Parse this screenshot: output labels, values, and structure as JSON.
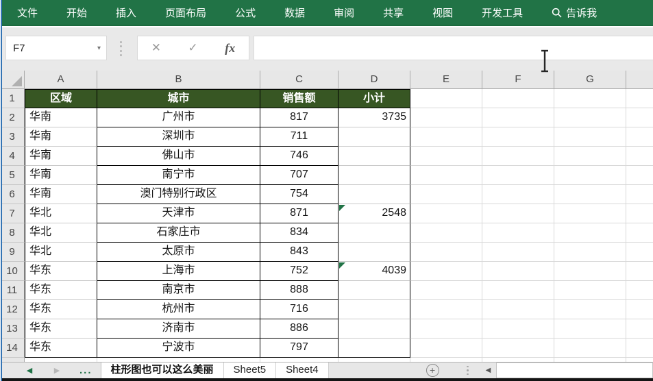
{
  "ribbon": {
    "tabs": [
      {
        "key": "file",
        "label": "文件"
      },
      {
        "key": "home",
        "label": "开始"
      },
      {
        "key": "insert",
        "label": "插入"
      },
      {
        "key": "page-layout",
        "label": "页面布局"
      },
      {
        "key": "formulas",
        "label": "公式"
      },
      {
        "key": "data",
        "label": "数据"
      },
      {
        "key": "review",
        "label": "审阅"
      },
      {
        "key": "share",
        "label": "共享"
      },
      {
        "key": "view",
        "label": "视图"
      },
      {
        "key": "developer",
        "label": "开发工具"
      }
    ],
    "tell_me_label": "告诉我"
  },
  "formula_bar": {
    "name_box_value": "F7",
    "cancel_label": "✕",
    "enter_label": "✓",
    "insert_function_label": "fx",
    "formula_value": ""
  },
  "grid": {
    "column_letters": [
      "A",
      "B",
      "C",
      "D",
      "E",
      "F",
      "G"
    ],
    "row_numbers": [
      1,
      2,
      3,
      4,
      5,
      6,
      7,
      8,
      9,
      10,
      11,
      12,
      13,
      14
    ],
    "header_row": {
      "region": "区域",
      "city": "城市",
      "sales": "销售额",
      "subtotal": "小计"
    },
    "rows": [
      {
        "region": "华南",
        "city": "广州市",
        "sales": "817",
        "subtotal": "3735",
        "flag": false
      },
      {
        "region": "华南",
        "city": "深圳市",
        "sales": "711",
        "subtotal": "",
        "flag": false
      },
      {
        "region": "华南",
        "city": "佛山市",
        "sales": "746",
        "subtotal": "",
        "flag": false
      },
      {
        "region": "华南",
        "city": "南宁市",
        "sales": "707",
        "subtotal": "",
        "flag": false
      },
      {
        "region": "华南",
        "city": "澳门特别行政区",
        "sales": "754",
        "subtotal": "",
        "flag": false
      },
      {
        "region": "华北",
        "city": "天津市",
        "sales": "871",
        "subtotal": "2548",
        "flag": true
      },
      {
        "region": "华北",
        "city": "石家庄市",
        "sales": "834",
        "subtotal": "",
        "flag": false
      },
      {
        "region": "华北",
        "city": "太原市",
        "sales": "843",
        "subtotal": "",
        "flag": false
      },
      {
        "region": "华东",
        "city": "上海市",
        "sales": "752",
        "subtotal": "4039",
        "flag": true
      },
      {
        "region": "华东",
        "city": "南京市",
        "sales": "888",
        "subtotal": "",
        "flag": false
      },
      {
        "region": "华东",
        "city": "杭州市",
        "sales": "716",
        "subtotal": "",
        "flag": false
      },
      {
        "region": "华东",
        "city": "济南市",
        "sales": "886",
        "subtotal": "",
        "flag": false
      },
      {
        "region": "华东",
        "city": "宁波市",
        "sales": "797",
        "subtotal": "",
        "flag": false
      }
    ]
  },
  "sheet_bar": {
    "nav_prev": "◀",
    "nav_next": "▶",
    "nav_more": "...",
    "tabs": [
      {
        "label": "柱形图也可以这么美丽",
        "active": true
      },
      {
        "label": "Sheet5",
        "active": false
      },
      {
        "label": "Sheet4",
        "active": false
      }
    ],
    "add_sheet": "+",
    "hscroll_left": "◀"
  },
  "colors": {
    "ribbon_green": "#217346",
    "table_header_green": "#375623",
    "flag_green": "#217346",
    "accent_left_edge": "#3474b4"
  }
}
